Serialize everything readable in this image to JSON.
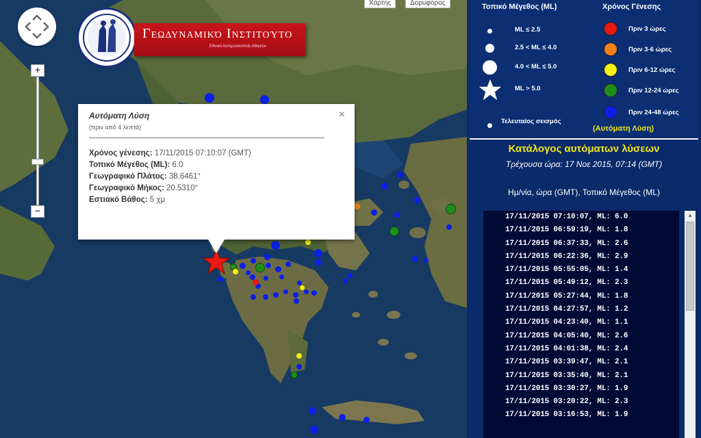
{
  "map": {
    "map_type_buttons": [
      "Χάρτης",
      "Δορυφόρος"
    ],
    "zoom_in": "+",
    "zoom_out": "−",
    "logo": {
      "title": "Γεωδυναμικό Ινστιτούτο",
      "subtitle": "Εθνικό Αστεροσκοπείο Αθηνών"
    },
    "infowindow": {
      "title": "Αυτόματη Λύση",
      "subtitle": "(πριν από 4 λεπτά)",
      "close": "×",
      "rows": [
        {
          "label": "Χρόνος γένεσης:",
          "value": "17/11/2015  07:10:07 (GMT)"
        },
        {
          "label": "Τοπικό Μέγεθος (ML):",
          "value": "6.0"
        },
        {
          "label": "Γεωγραφικό Πλάτος:",
          "value": "38.6461°"
        },
        {
          "label": "Γεωγραφικό Μήκος:",
          "value": "20.5310°"
        },
        {
          "label": "Εστιακό Βάθος:",
          "value": "5 χμ"
        }
      ]
    },
    "marker_colors": {
      "blue": "#0b1fe8",
      "green": "#1f8f1c",
      "yellow": "#f2f21a",
      "red": "#e8190f",
      "orange": "#f0801a",
      "latest_star": "#e8190f"
    }
  },
  "legend": {
    "magnitude_heading": "Τοπικό Μέγεθος (ML)",
    "time_heading": "Χρόνος Γένεσης",
    "magnitude_items": [
      "ML ≤ 2.5",
      "2.5 < ML ≤ 4.0",
      "4.0 < ML ≤ 5.0",
      "ML > 5.0",
      "Τελευταίος σεισμός"
    ],
    "time_items": [
      {
        "label": "Πριν 3 ώρες",
        "color": "#e8190f"
      },
      {
        "label": "Πριν 3-6 ώρες",
        "color": "#f0801a"
      },
      {
        "label": "Πριν 6-12 ώρες",
        "color": "#f2f21a"
      },
      {
        "label": "Πριν 12-24 ώρες",
        "color": "#1f8f1c"
      },
      {
        "label": "Πριν 24-48 ώρες",
        "color": "#0b1fe8"
      }
    ],
    "auto_note": "(Αυτόματη Λύση)"
  },
  "catalog": {
    "title": "Κατάλογος αυτόματων λύσεων",
    "current_time": "Τρέχουσα ώρα: 17 Νοε 2015, 07:14 (GMT)",
    "columns_header": "Ημ/νία, ώρα (GMT), Τοπικό Μέγεθος (ML)",
    "entries": [
      "17/11/2015 07:10:07,  ML: 6.0",
      "17/11/2015 06:59:19,  ML: 1.8",
      "17/11/2015 06:37:33,  ML: 2.6",
      "17/11/2015 06:22:36,  ML: 2.9",
      "17/11/2015 05:55:05,  ML: 1.4",
      "17/11/2015 05:49:12,  ML: 2.3",
      "17/11/2015 05:27:44,  ML: 1.8",
      "17/11/2015 04:27:57,  ML: 1.2",
      "17/11/2015 04:23:40,  ML: 1.1",
      "17/11/2015 04:05:40,  ML: 2.6",
      "17/11/2015 04:01:38,  ML: 2.4",
      "17/11/2015 03:39:47,  ML: 2.1",
      "17/11/2015 03:35:40,  ML: 2.1",
      "17/11/2015 03:30:27,  ML: 1.9",
      "17/11/2015 03:20:22,  ML: 2.3",
      "17/11/2015 03:16:53,  ML: 1.9"
    ]
  }
}
